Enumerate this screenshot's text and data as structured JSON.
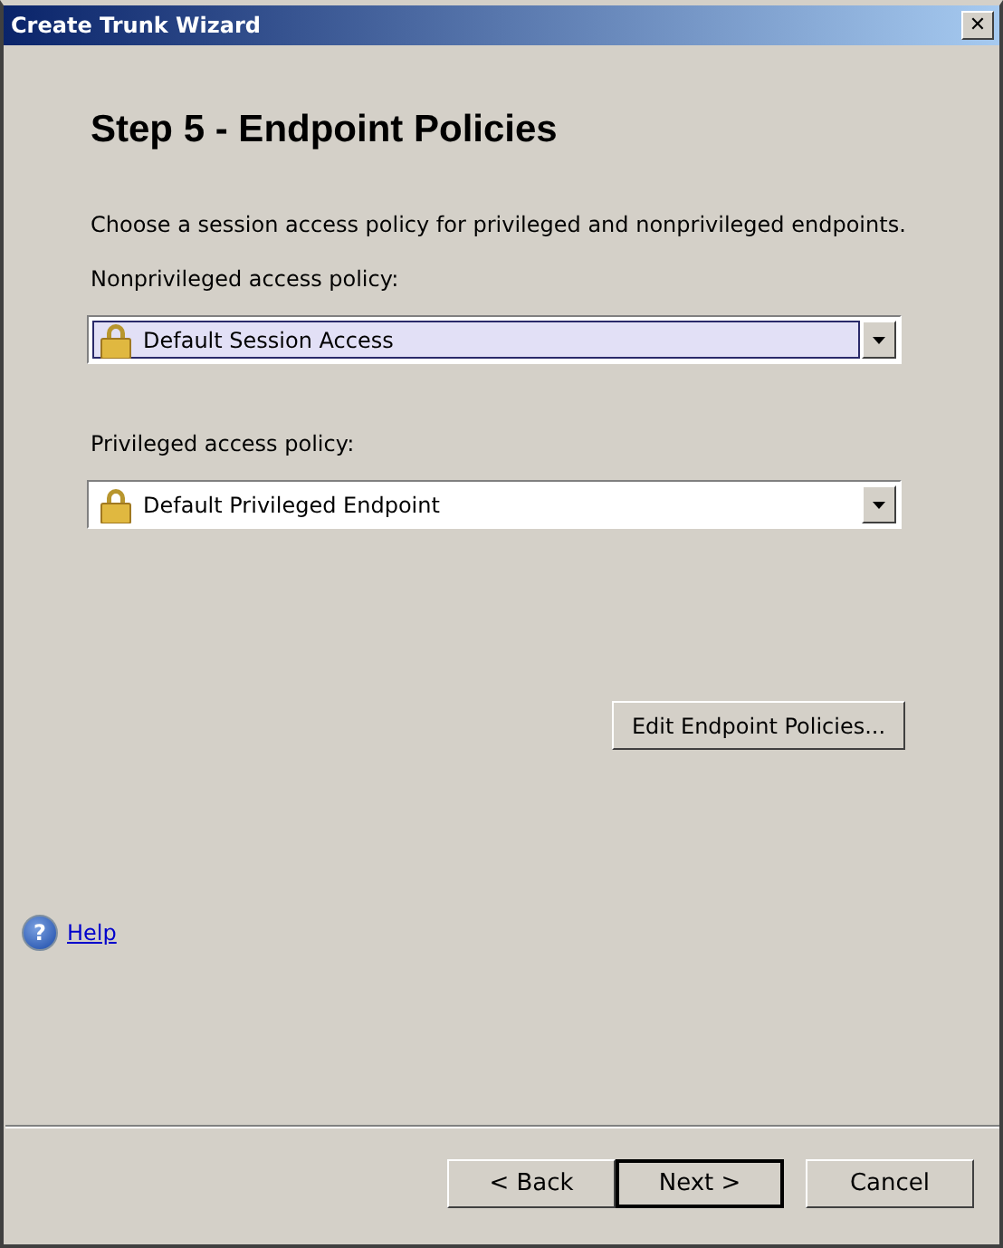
{
  "window": {
    "title": "Create Trunk Wizard",
    "close": "✕"
  },
  "heading": "Step 5 - Endpoint Policies",
  "description": "Choose a session access policy for privileged and nonprivileged endpoints.",
  "policies": [
    {
      "label": "Nonprivileged access policy:",
      "value": "Default Session Access",
      "focused": true
    },
    {
      "label": "Privileged access policy:",
      "value": "Default Privileged Endpoint",
      "focused": false
    }
  ],
  "edit_button": "Edit Endpoint Policies...",
  "help": {
    "icon": "?",
    "label": "Help"
  },
  "buttons": [
    {
      "label": "< Back",
      "default": false
    },
    {
      "label": "Next >",
      "default": true
    },
    {
      "label": "Cancel",
      "default": false
    }
  ]
}
